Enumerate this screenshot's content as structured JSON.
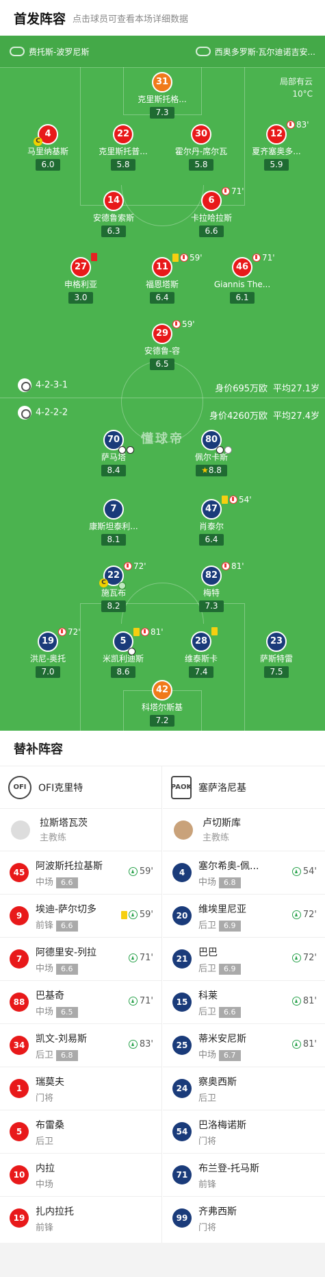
{
  "header": {
    "title": "首发阵容",
    "subtitle": "点击球员可查看本场详细数据"
  },
  "teams": {
    "home": "费托斯-波罗尼斯",
    "away": "西奥多罗斯·瓦尔迪诺吉安..."
  },
  "weather": {
    "desc": "局部有云",
    "temp": "10°C"
  },
  "watermark": "懂球帝",
  "home_info": {
    "formation": "4-2-3-1",
    "value": "身价695万欧",
    "age": "平均27.1岁"
  },
  "away_info": {
    "formation": "4-2-2-2",
    "value": "身价4260万欧",
    "age": "平均27.4岁"
  },
  "home_players": [
    {
      "num": "31",
      "name": "克里斯托格...",
      "rating": "7.3"
    },
    {
      "num": "4",
      "name": "马里纳基斯",
      "rating": "6.0"
    },
    {
      "num": "22",
      "name": "克里斯托普...",
      "rating": "5.8"
    },
    {
      "num": "30",
      "name": "霍尔丹-席尔瓦",
      "rating": "5.8"
    },
    {
      "num": "12",
      "name": "夏齐塞奥多...",
      "rating": "5.9",
      "sub": "83'"
    },
    {
      "num": "14",
      "name": "安德鲁索斯",
      "rating": "6.3"
    },
    {
      "num": "6",
      "name": "卡拉哈拉斯",
      "rating": "6.6",
      "sub": "71'"
    },
    {
      "num": "27",
      "name": "申格利亚",
      "rating": "3.0"
    },
    {
      "num": "11",
      "name": "福恩塔斯",
      "rating": "6.4",
      "sub": "59'"
    },
    {
      "num": "46",
      "name": "Giannis The...",
      "rating": "6.1",
      "sub": "71'"
    },
    {
      "num": "29",
      "name": "安德鲁-容",
      "rating": "6.5",
      "sub": "59'"
    }
  ],
  "away_players": [
    {
      "num": "70",
      "name": "萨马塔",
      "rating": "8.4"
    },
    {
      "num": "80",
      "name": "佩尔卡斯",
      "rating": "8.8"
    },
    {
      "num": "7",
      "name": "康斯坦泰利...",
      "rating": "8.1"
    },
    {
      "num": "47",
      "name": "肖泰尔",
      "rating": "6.4",
      "sub": "54'"
    },
    {
      "num": "22",
      "name": "施瓦布",
      "rating": "8.2",
      "sub": "72'"
    },
    {
      "num": "82",
      "name": "梅特",
      "rating": "7.3",
      "sub": "81'"
    },
    {
      "num": "19",
      "name": "洪尼-奥托",
      "rating": "7.0",
      "sub": "72'"
    },
    {
      "num": "5",
      "name": "米凯利迪斯",
      "rating": "8.6",
      "sub": "81'"
    },
    {
      "num": "28",
      "name": "维泰斯卡",
      "rating": "7.4"
    },
    {
      "num": "23",
      "name": "萨斯特雷",
      "rating": "7.5"
    },
    {
      "num": "42",
      "name": "科塔尔斯基",
      "rating": "7.2"
    }
  ],
  "subs": {
    "title": "替补阵容",
    "home": {
      "team": "OFI克里特",
      "logo": "OFI",
      "coach": "拉斯塔瓦茨",
      "coach_role": "主教练",
      "players": [
        {
          "num": "45",
          "name": "阿波斯托拉基斯",
          "pos": "中场",
          "rating": "6.6",
          "time": "59'"
        },
        {
          "num": "9",
          "name": "埃迪-萨尔切多",
          "pos": "前锋",
          "rating": "6.6",
          "time": "59'"
        },
        {
          "num": "7",
          "name": "阿德里安-列拉",
          "pos": "中场",
          "rating": "6.6",
          "time": "71'"
        },
        {
          "num": "88",
          "name": "巴基奇",
          "pos": "中场",
          "rating": "6.5",
          "time": "71'"
        },
        {
          "num": "34",
          "name": "凯文-刘易斯",
          "pos": "后卫",
          "rating": "6.8",
          "time": "83'"
        },
        {
          "num": "1",
          "name": "瑞莫夫",
          "pos": "门将"
        },
        {
          "num": "5",
          "name": "布雷桑",
          "pos": "后卫"
        },
        {
          "num": "10",
          "name": "内拉",
          "pos": "中场"
        },
        {
          "num": "19",
          "name": "扎内拉托",
          "pos": "前锋"
        }
      ]
    },
    "away": {
      "team": "塞萨洛尼基",
      "logo": "PAOK",
      "coach": "卢切斯库",
      "coach_role": "主教练",
      "players": [
        {
          "num": "4",
          "name": "塞尔希奥-佩...",
          "pos": "中场",
          "rating": "6.8",
          "time": "54'"
        },
        {
          "num": "20",
          "name": "维埃里尼亚",
          "pos": "后卫",
          "rating": "6.9",
          "time": "72'"
        },
        {
          "num": "21",
          "name": "巴巴",
          "pos": "后卫",
          "rating": "6.9",
          "time": "72'"
        },
        {
          "num": "15",
          "name": "科莱",
          "pos": "后卫",
          "rating": "6.6",
          "time": "81'"
        },
        {
          "num": "25",
          "name": "蒂米安尼斯",
          "pos": "中场",
          "rating": "6.7",
          "time": "81'"
        },
        {
          "num": "24",
          "name": "察奥西斯",
          "pos": "后卫"
        },
        {
          "num": "54",
          "name": "巴洛梅诺斯",
          "pos": "门将"
        },
        {
          "num": "71",
          "name": "布兰登-托马斯",
          "pos": "前锋"
        },
        {
          "num": "99",
          "name": "齐弗西斯",
          "pos": "门将"
        }
      ]
    }
  },
  "colors": {
    "pitch": "#4bb34f",
    "home": "#e8191a",
    "away": "#1a3b7a",
    "gk": "#f07a1a"
  }
}
